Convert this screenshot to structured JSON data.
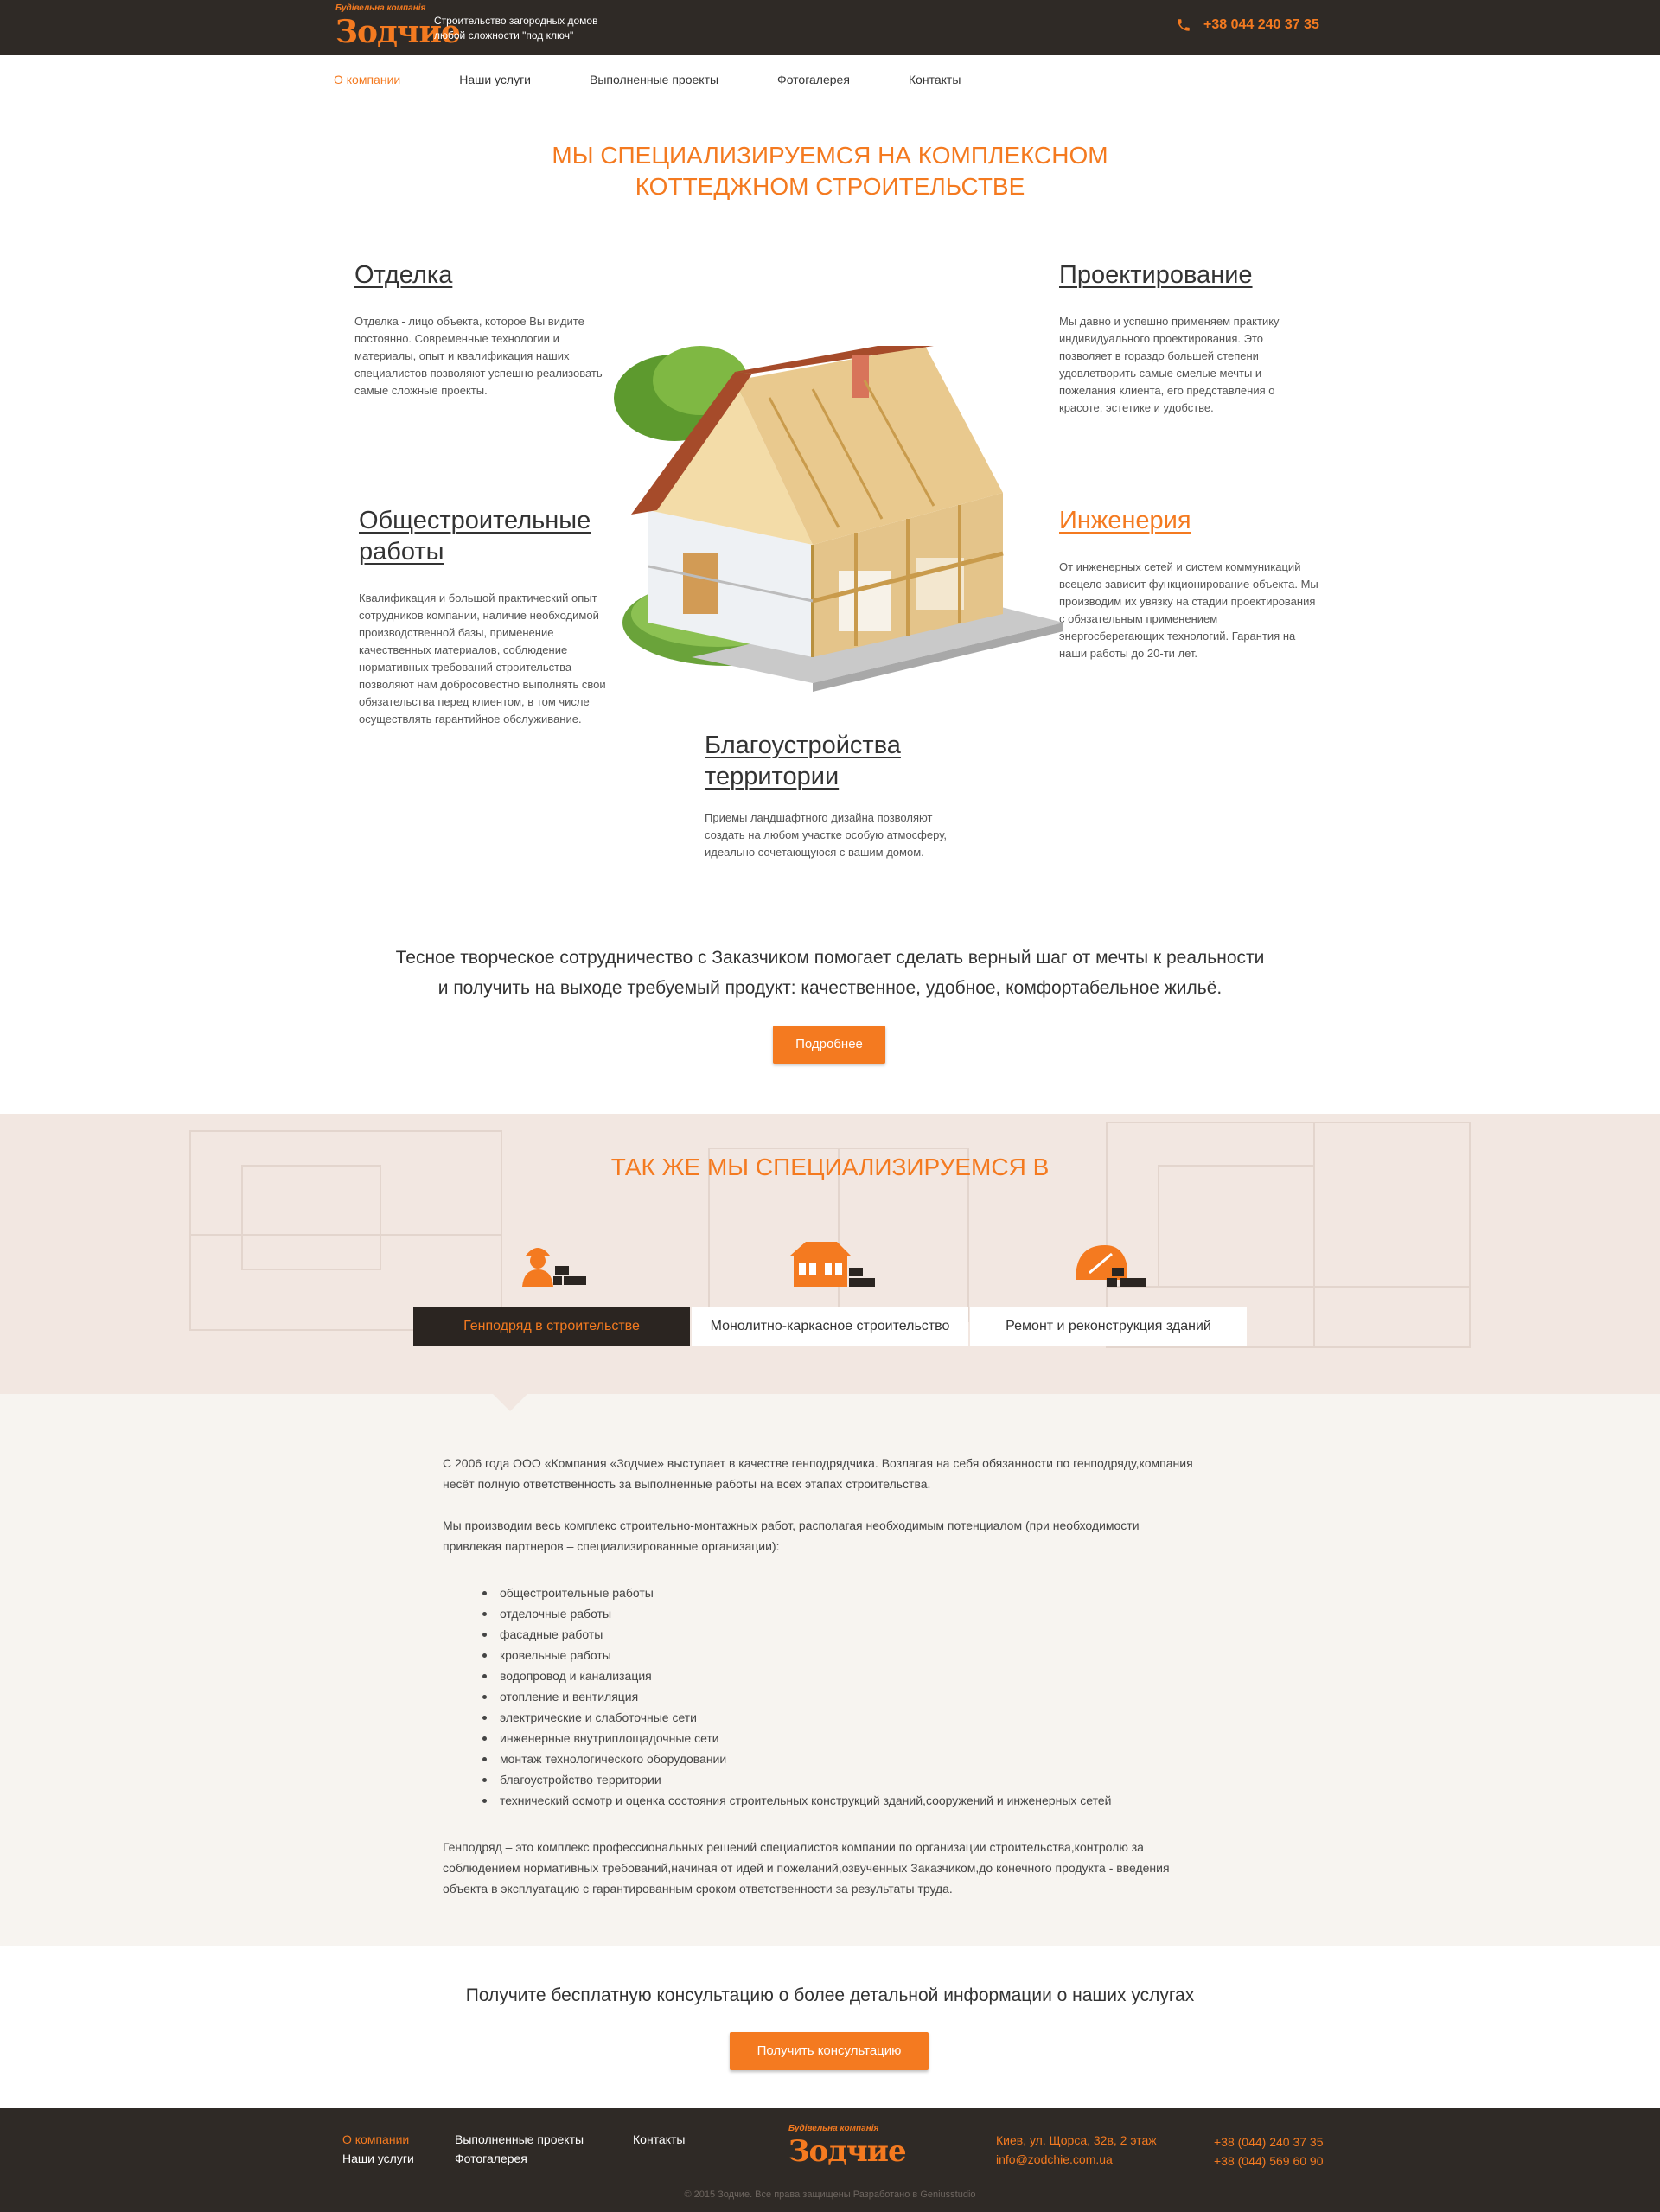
{
  "header": {
    "logo_small": "Будівельна компанія",
    "logo_big": "Зодчие",
    "tagline_line1": "Строительство  загородных  домов",
    "tagline_line2": "любой  сложности  \"под  ключ\"",
    "phone": "+38 044 240 37 35"
  },
  "nav": {
    "items": [
      "О компании",
      "Наши услуги",
      "Выполненные проекты",
      "Фотогалерея",
      "Контакты"
    ],
    "active": "О компании"
  },
  "hero": {
    "title_line1": "МЫ СПЕЦИАЛИЗИРУЕМСЯ НА КОМПЛЕКСНОМ",
    "title_line2": "КОТТЕДЖНОМ СТРОИТЕЛЬСТВЕ"
  },
  "services": [
    {
      "title": "Отделка",
      "text": "Отделка - лицо объекта, которое Вы видите постоянно. Современные технологии и материалы, опыт и квалификация наших специалистов позволяют успешно реализовать самые сложные проекты."
    },
    {
      "title": "Проектирование",
      "text": "Мы давно и успешно применяем практику индивидуального проектирования. Это позволяет в гораздо большей степени удовлетворить самые смелые мечты и пожелания клиента, его представления о красоте, эстетике и удобстве."
    },
    {
      "title_line1": "Общестроительные",
      "title_line2": "работы",
      "text": "Квалификация и большой практический опыт сотрудников компании, наличие необходимой производственной базы, применение качественных материалов, соблюдение нормативных требований строительства позволяют нам добросовестно выполнять свои обязательства перед клиентом, в том числе осуществлять гарантийное обслуживание."
    },
    {
      "title": "Инженерия",
      "text": "От инженерных сетей и систем коммуникаций всецело зависит функционирование объекта. Мы производим их увязку на стадии проектирования с обязательным применением энергосберегающих технологий. Гарантия на наши работы до 20-ти лет."
    },
    {
      "title_line1": "Благоустройства",
      "title_line2": "территории",
      "text": "Приемы ландшафтного дизайна позволяют создать на любом участке особую атмосферу, идеально сочетающуюся с вашим домом."
    }
  ],
  "quote": {
    "line1": "Тесное творческое сотрудничество с Заказчиком помогает сделать  верный шаг от мечты к реальности",
    "line2": "и получить на выходе требуемый продукт: качественное, удобное, комфортабельное жильё.",
    "button": "Подробнее"
  },
  "also": {
    "title": "ТАК ЖЕ МЫ СПЕЦИАЛИЗИРУЕМСЯ В",
    "tabs": [
      "Генподряд в строительстве",
      "Монолитно-каркасное строительство",
      "Ремонт и реконструкция зданий"
    ],
    "icons": [
      "worker-icon",
      "building-icon",
      "helmet-icon"
    ]
  },
  "content": {
    "p1_line1": "С 2006 года ООО «Компания «Зодчие» выступает в качестве генподрядчика. Возлагая на себя обязанности по генподряду,компания",
    "p1_line2": "несёт полную ответственность за выполненные работы на всех этапах строительства.",
    "p2_line1": "Мы производим весь комплекс строительно-монтажных работ, располагая необходимым потенциалом (при необходимости",
    "p2_line2": "привлекая партнеров – специализированные организации):",
    "bullets": [
      "общестроительные работы",
      "отделочные работы",
      "фасадные работы",
      "кровельные работы",
      "водопровод и канализация",
      "отопление и вентиляция",
      "электрические и слаботочные сети",
      "инженерные внутриплощадочные сети",
      "монтаж технологического оборудовании",
      "благоустройство территории",
      "технический осмотр и оценка состояния строительных конструкций зданий,сооружений и инженерных сетей"
    ],
    "p3_line1": "Генподряд – это комплекс профессиональных решений специалистов компании  по организации строительства,контролю за",
    "p3_line2": "соблюдением нормативных требований,начиная от идей и пожеланий,озвученных Заказчиком,до конечного продукта - введения",
    "p3_line3": "объекта в эксплуатацию с гарантированным сроком ответственности за результаты труда."
  },
  "consult": {
    "text": "Получите бесплатную консультацию о более детальной информации о наших услугах",
    "button": "Получить консультацию"
  },
  "footer": {
    "links": [
      "О компании",
      "Наши услуги",
      "Выполненные проекты",
      "Фотогалерея",
      "Контакты"
    ],
    "address": "Киев, ул. Щорса, 32в, 2 этаж",
    "email": "info@zodchie.com.ua",
    "phone1": "+38 (044) 240 37 35",
    "phone2": "+38 (044) 569 60 90",
    "copyright": "© 2015 Зодчие. Все права защищены    Разработано в Geniusstudio"
  },
  "colors": {
    "accent": "#f47a20",
    "dark": "#2f2a26",
    "band": "#f2e7e1",
    "content_bg": "#f7f4f0"
  }
}
